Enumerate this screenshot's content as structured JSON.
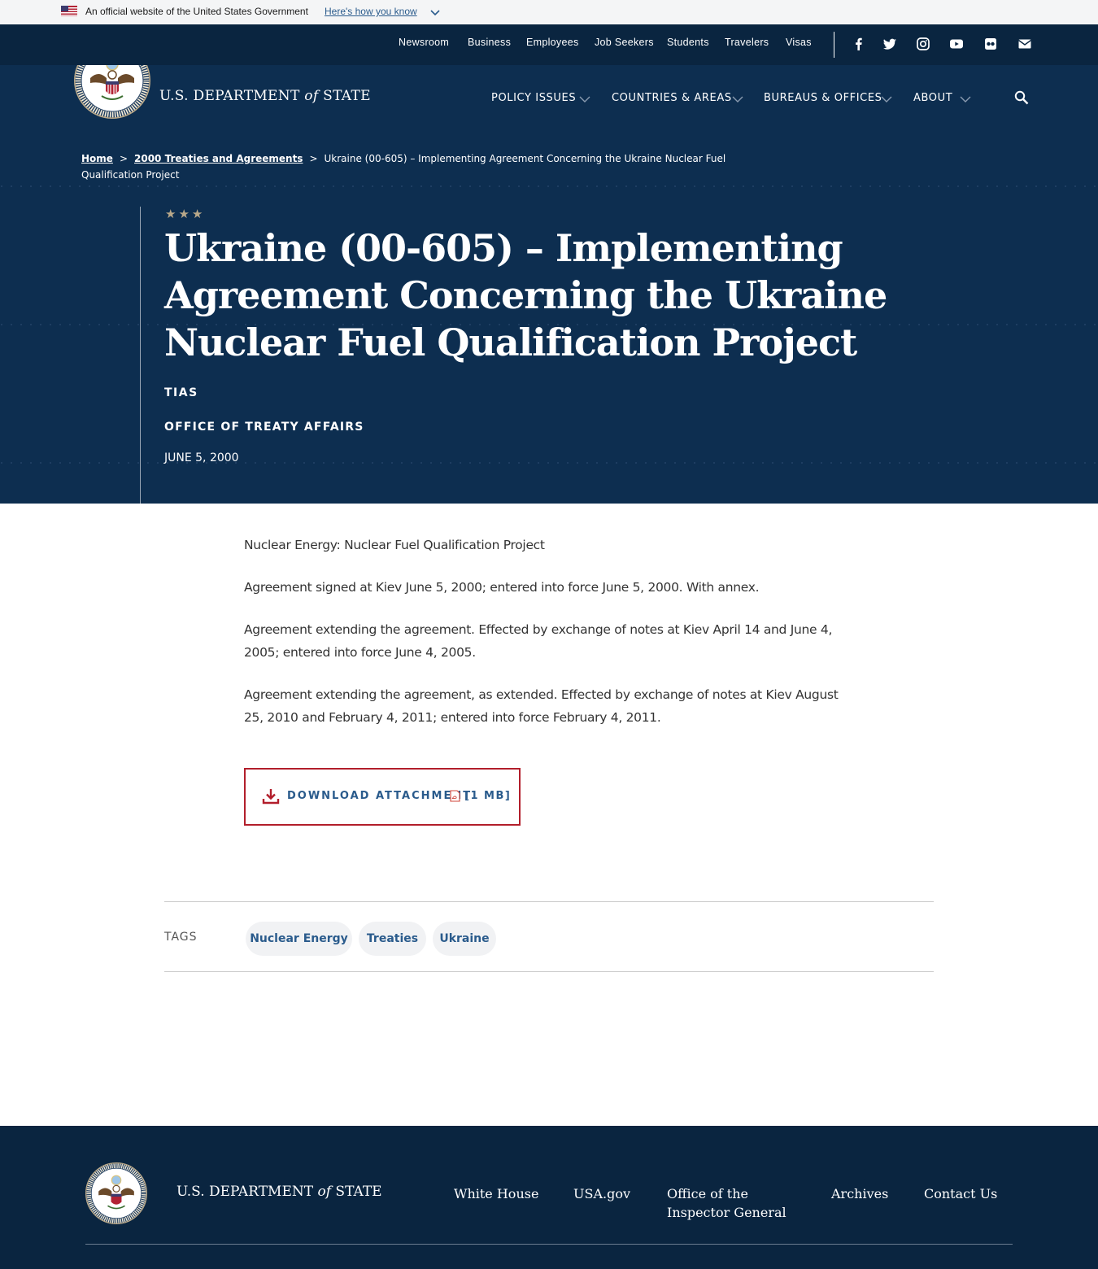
{
  "gov_banner": {
    "official_text": "An official website of the United States Government",
    "how_link": "Here's how you know"
  },
  "utility_nav": {
    "items": [
      "Newsroom",
      "Business",
      "Employees",
      "Job Seekers",
      "Students",
      "Travelers",
      "Visas"
    ],
    "social_icons": [
      "facebook-icon",
      "twitter-icon",
      "instagram-icon",
      "youtube-icon",
      "flickr-icon",
      "email-icon"
    ]
  },
  "masthead": {
    "wordmark_pre": "U.S. DEPARTMENT ",
    "wordmark_of": "of",
    "wordmark_post": " STATE",
    "nav": [
      "POLICY ISSUES",
      "COUNTRIES & AREAS",
      "BUREAUS & OFFICES",
      "ABOUT"
    ]
  },
  "breadcrumb": {
    "home": "Home",
    "parent": "2000 Treaties and Agreements",
    "current": "Ukraine (00-605) – Implementing Agreement Concerning the Ukraine Nuclear Fuel Qualification Project",
    "separator": ">"
  },
  "header": {
    "stars": "★★★",
    "title": "Ukraine (00-605) – Implementing Agreement Concerning the Ukraine Nuclear Fuel Qualification Project",
    "tag1": "TIAS",
    "tag2": "OFFICE OF TREATY AFFAIRS",
    "date": "JUNE 5, 2000"
  },
  "content": {
    "p1": "Nuclear Energy: Nuclear Fuel Qualification Project",
    "p2": "Agreement signed at Kiev June 5, 2000; entered into force June 5, 2000.  With annex.",
    "p3": "Agreement extending the agreement. Effected by exchange of notes at Kiev April 14 and June 4, 2005; entered into force June 4, 2005.",
    "p4": "Agreement extending the agreement, as extended.  Effected by exchange of notes at Kiev August 25, 2010 and February 4, 2011; entered into force February 4, 2011."
  },
  "download": {
    "label": "DOWNLOAD ATTACHMENT",
    "size": "[1 MB]"
  },
  "tags": {
    "label": "TAGS",
    "items": [
      "Nuclear Energy",
      "Treaties",
      "Ukraine"
    ]
  },
  "footer": {
    "wordmark_pre": "U.S. DEPARTMENT ",
    "wordmark_of": "of",
    "wordmark_post": " STATE",
    "links": [
      "White House",
      "USA.gov",
      "Office of the Inspector General",
      "Archives",
      "Contact Us"
    ]
  },
  "colors": {
    "navy_dark": "#0a2540",
    "navy": "#0d2e50",
    "accent_red": "#b21e2b",
    "link_blue": "#2a5b8c",
    "gold": "#b8a88a"
  }
}
